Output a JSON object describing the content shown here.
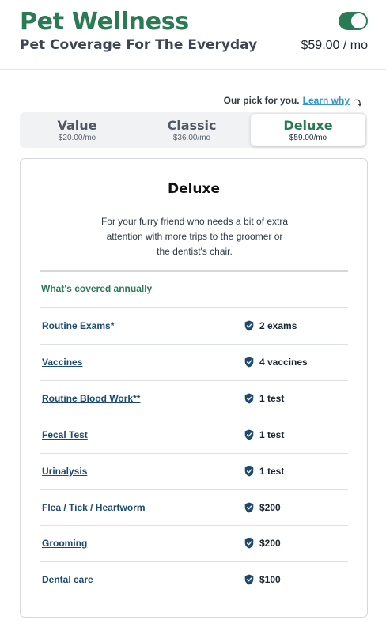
{
  "brand": {
    "title": "Pet Wellness",
    "subtitle": "Pet Coverage For The Everyday"
  },
  "header": {
    "price": "$59.00 / mo",
    "toggle_on": true
  },
  "recommendation": {
    "text": "Our pick for you.",
    "link": "Learn why"
  },
  "plans": [
    {
      "name": "Value",
      "price": "$20.00/mo",
      "active": false
    },
    {
      "name": "Classic",
      "price": "$36.00/mo",
      "active": false
    },
    {
      "name": "Deluxe",
      "price": "$59.00/mo",
      "active": true
    }
  ],
  "card": {
    "title": "Deluxe",
    "description_lines": [
      "For your furry friend who needs a bit of extra",
      "attention with more trips to the groomer or",
      "the dentist's chair."
    ],
    "covered_heading": "What's covered annually",
    "items": [
      {
        "label": "Routine Exams*",
        "value": "2 exams"
      },
      {
        "label": "Vaccines",
        "value": "4 vaccines"
      },
      {
        "label": "Routine Blood Work**",
        "value": "1 test"
      },
      {
        "label": "Fecal Test",
        "value": "1 test"
      },
      {
        "label": "Urinalysis",
        "value": "1 test"
      },
      {
        "label": "Flea / Tick / Heartworm",
        "value": "$200"
      },
      {
        "label": "Grooming",
        "value": "$200"
      },
      {
        "label": "Dental care",
        "value": "$100"
      }
    ]
  },
  "colors": {
    "brand_green": "#2a7a55",
    "link_blue": "#3c95c9",
    "item_navy": "#1d4a6e",
    "shield": "#1d4a6e"
  },
  "icons": {
    "toggle": "toggle-switch-on",
    "item": "shield-check-icon",
    "link": "curved-arrow-icon"
  }
}
